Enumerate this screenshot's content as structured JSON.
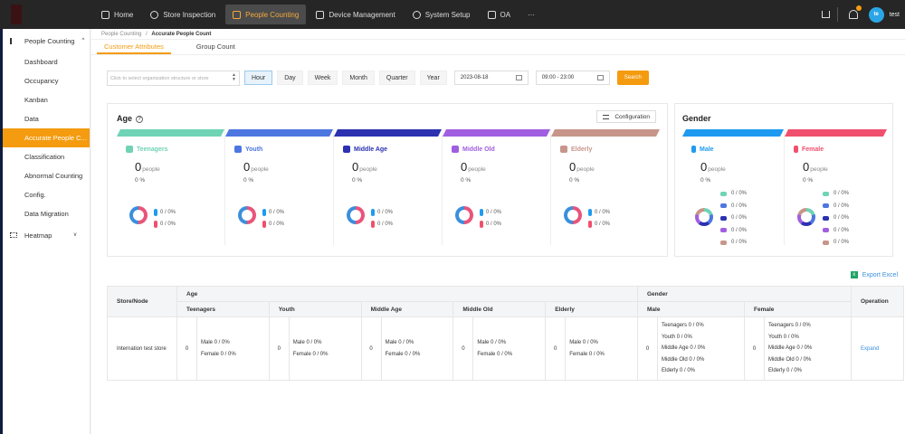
{
  "topbar": {
    "nav": [
      {
        "label": "Home",
        "icon": "home-icon",
        "active": false
      },
      {
        "label": "Store Inspection",
        "icon": "camera-icon",
        "active": false
      },
      {
        "label": "People Counting",
        "icon": "people-counting-icon",
        "active": true
      },
      {
        "label": "Device Management",
        "icon": "device-icon",
        "active": false
      },
      {
        "label": "System Setup",
        "icon": "settings-icon",
        "active": false
      },
      {
        "label": "OA",
        "icon": "calendar-icon",
        "active": false
      },
      {
        "label": "···",
        "icon": "more-icon",
        "active": false
      }
    ],
    "avatar": "te",
    "username": "test"
  },
  "sidebar": {
    "group1": "People Counting",
    "items": [
      "Dashboard",
      "Occupancy",
      "Kanban",
      "Data",
      "Accurate People C...",
      "Classification",
      "Abnormal Counting",
      "Config.",
      "Data Migration"
    ],
    "active_index": 4,
    "group2": "Heatmap"
  },
  "breadcrumb": {
    "parent": "People Counting",
    "sep": "/",
    "current": "Accurate People Count"
  },
  "tabs": [
    "Customer Attributes",
    "Group Count"
  ],
  "filters": {
    "org_placeholder": "Click to select organization structure or store",
    "periods": [
      "Hour",
      "Day",
      "Week",
      "Month",
      "Quarter",
      "Year"
    ],
    "active_period": "Hour",
    "date": "2023-08-18",
    "time": "09:00 - 23:00",
    "search": "Search"
  },
  "age": {
    "title": "Age",
    "config": "Configuration",
    "unit": "people",
    "groups": [
      {
        "name": "Teenagers",
        "color": "#6fd3b5",
        "count": "0",
        "pct": "0 %",
        "male": "0 / 0%",
        "female": "0 / 0%"
      },
      {
        "name": "Youth",
        "color": "#4d76e0",
        "count": "0",
        "pct": "0 %",
        "male": "0 / 0%",
        "female": "0 / 0%"
      },
      {
        "name": "Middle Age",
        "color": "#2b31b0",
        "count": "0",
        "pct": "0 %",
        "male": "0 / 0%",
        "female": "0 / 0%"
      },
      {
        "name": "Middle Old",
        "color": "#a05ee0",
        "count": "0",
        "pct": "0 %",
        "male": "0 / 0%",
        "female": "0 / 0%"
      },
      {
        "name": "Elderly",
        "color": "#c7958a",
        "count": "0",
        "pct": "0 %",
        "male": "0 / 0%",
        "female": "0 / 0%"
      }
    ]
  },
  "gender": {
    "title": "Gender",
    "unit": "people",
    "groups": [
      {
        "name": "Male",
        "color": "#1e9bf0",
        "count": "0",
        "pct": "0 %",
        "ages": [
          "0 / 0%",
          "0 / 0%",
          "0 / 0%",
          "0 / 0%",
          "0 / 0%"
        ]
      },
      {
        "name": "Female",
        "color": "#f0506e",
        "count": "0",
        "pct": "0 %",
        "ages": [
          "0 / 0%",
          "0 / 0%",
          "0 / 0%",
          "0 / 0%",
          "0 / 0%"
        ]
      }
    ]
  },
  "export": "Export Excel",
  "table": {
    "h_store": "Store/Node",
    "h_age": "Age",
    "h_gender": "Gender",
    "h_operation": "Operation",
    "age_cols": [
      "Teenagers",
      "Youth",
      "Middle Age",
      "Middle Old",
      "Elderly"
    ],
    "gender_cols": [
      "Male",
      "Female"
    ],
    "row": {
      "store": "Internation test store",
      "age_counts": [
        "0",
        "0",
        "0",
        "0",
        "0"
      ],
      "male_line": "Male  0 / 0%",
      "female_line": "Female  0 / 0%",
      "gender_counts": [
        "0",
        "0"
      ],
      "gender_breakdown": [
        "Teenagers  0 / 0%",
        "Youth  0 / 0%",
        "Middle Age  0 / 0%",
        "Middle Old  0 / 0%",
        "Elderly  0 / 0%"
      ],
      "action": "Expand"
    }
  }
}
